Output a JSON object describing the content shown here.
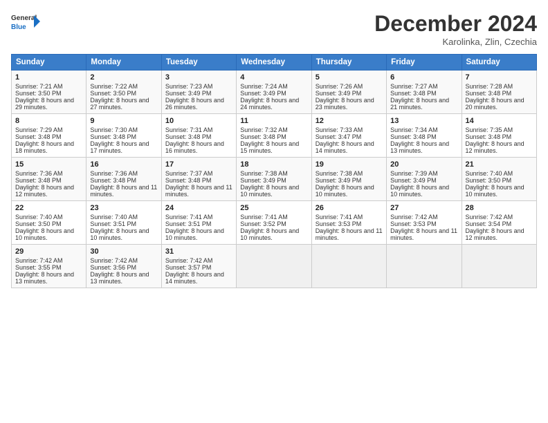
{
  "header": {
    "logo_line1": "General",
    "logo_line2": "Blue",
    "month_title": "December 2024",
    "location": "Karolinka, Zlin, Czechia"
  },
  "days_of_week": [
    "Sunday",
    "Monday",
    "Tuesday",
    "Wednesday",
    "Thursday",
    "Friday",
    "Saturday"
  ],
  "weeks": [
    [
      {
        "day": "1",
        "sunrise": "Sunrise: 7:21 AM",
        "sunset": "Sunset: 3:50 PM",
        "daylight": "Daylight: 8 hours and 29 minutes."
      },
      {
        "day": "2",
        "sunrise": "Sunrise: 7:22 AM",
        "sunset": "Sunset: 3:50 PM",
        "daylight": "Daylight: 8 hours and 27 minutes."
      },
      {
        "day": "3",
        "sunrise": "Sunrise: 7:23 AM",
        "sunset": "Sunset: 3:49 PM",
        "daylight": "Daylight: 8 hours and 26 minutes."
      },
      {
        "day": "4",
        "sunrise": "Sunrise: 7:24 AM",
        "sunset": "Sunset: 3:49 PM",
        "daylight": "Daylight: 8 hours and 24 minutes."
      },
      {
        "day": "5",
        "sunrise": "Sunrise: 7:26 AM",
        "sunset": "Sunset: 3:49 PM",
        "daylight": "Daylight: 8 hours and 23 minutes."
      },
      {
        "day": "6",
        "sunrise": "Sunrise: 7:27 AM",
        "sunset": "Sunset: 3:48 PM",
        "daylight": "Daylight: 8 hours and 21 minutes."
      },
      {
        "day": "7",
        "sunrise": "Sunrise: 7:28 AM",
        "sunset": "Sunset: 3:48 PM",
        "daylight": "Daylight: 8 hours and 20 minutes."
      }
    ],
    [
      {
        "day": "8",
        "sunrise": "Sunrise: 7:29 AM",
        "sunset": "Sunset: 3:48 PM",
        "daylight": "Daylight: 8 hours and 18 minutes."
      },
      {
        "day": "9",
        "sunrise": "Sunrise: 7:30 AM",
        "sunset": "Sunset: 3:48 PM",
        "daylight": "Daylight: 8 hours and 17 minutes."
      },
      {
        "day": "10",
        "sunrise": "Sunrise: 7:31 AM",
        "sunset": "Sunset: 3:48 PM",
        "daylight": "Daylight: 8 hours and 16 minutes."
      },
      {
        "day": "11",
        "sunrise": "Sunrise: 7:32 AM",
        "sunset": "Sunset: 3:48 PM",
        "daylight": "Daylight: 8 hours and 15 minutes."
      },
      {
        "day": "12",
        "sunrise": "Sunrise: 7:33 AM",
        "sunset": "Sunset: 3:47 PM",
        "daylight": "Daylight: 8 hours and 14 minutes."
      },
      {
        "day": "13",
        "sunrise": "Sunrise: 7:34 AM",
        "sunset": "Sunset: 3:48 PM",
        "daylight": "Daylight: 8 hours and 13 minutes."
      },
      {
        "day": "14",
        "sunrise": "Sunrise: 7:35 AM",
        "sunset": "Sunset: 3:48 PM",
        "daylight": "Daylight: 8 hours and 12 minutes."
      }
    ],
    [
      {
        "day": "15",
        "sunrise": "Sunrise: 7:36 AM",
        "sunset": "Sunset: 3:48 PM",
        "daylight": "Daylight: 8 hours and 12 minutes."
      },
      {
        "day": "16",
        "sunrise": "Sunrise: 7:36 AM",
        "sunset": "Sunset: 3:48 PM",
        "daylight": "Daylight: 8 hours and 11 minutes."
      },
      {
        "day": "17",
        "sunrise": "Sunrise: 7:37 AM",
        "sunset": "Sunset: 3:48 PM",
        "daylight": "Daylight: 8 hours and 11 minutes."
      },
      {
        "day": "18",
        "sunrise": "Sunrise: 7:38 AM",
        "sunset": "Sunset: 3:49 PM",
        "daylight": "Daylight: 8 hours and 10 minutes."
      },
      {
        "day": "19",
        "sunrise": "Sunrise: 7:38 AM",
        "sunset": "Sunset: 3:49 PM",
        "daylight": "Daylight: 8 hours and 10 minutes."
      },
      {
        "day": "20",
        "sunrise": "Sunrise: 7:39 AM",
        "sunset": "Sunset: 3:49 PM",
        "daylight": "Daylight: 8 hours and 10 minutes."
      },
      {
        "day": "21",
        "sunrise": "Sunrise: 7:40 AM",
        "sunset": "Sunset: 3:50 PM",
        "daylight": "Daylight: 8 hours and 10 minutes."
      }
    ],
    [
      {
        "day": "22",
        "sunrise": "Sunrise: 7:40 AM",
        "sunset": "Sunset: 3:50 PM",
        "daylight": "Daylight: 8 hours and 10 minutes."
      },
      {
        "day": "23",
        "sunrise": "Sunrise: 7:40 AM",
        "sunset": "Sunset: 3:51 PM",
        "daylight": "Daylight: 8 hours and 10 minutes."
      },
      {
        "day": "24",
        "sunrise": "Sunrise: 7:41 AM",
        "sunset": "Sunset: 3:51 PM",
        "daylight": "Daylight: 8 hours and 10 minutes."
      },
      {
        "day": "25",
        "sunrise": "Sunrise: 7:41 AM",
        "sunset": "Sunset: 3:52 PM",
        "daylight": "Daylight: 8 hours and 10 minutes."
      },
      {
        "day": "26",
        "sunrise": "Sunrise: 7:41 AM",
        "sunset": "Sunset: 3:53 PM",
        "daylight": "Daylight: 8 hours and 11 minutes."
      },
      {
        "day": "27",
        "sunrise": "Sunrise: 7:42 AM",
        "sunset": "Sunset: 3:53 PM",
        "daylight": "Daylight: 8 hours and 11 minutes."
      },
      {
        "day": "28",
        "sunrise": "Sunrise: 7:42 AM",
        "sunset": "Sunset: 3:54 PM",
        "daylight": "Daylight: 8 hours and 12 minutes."
      }
    ],
    [
      {
        "day": "29",
        "sunrise": "Sunrise: 7:42 AM",
        "sunset": "Sunset: 3:55 PM",
        "daylight": "Daylight: 8 hours and 13 minutes."
      },
      {
        "day": "30",
        "sunrise": "Sunrise: 7:42 AM",
        "sunset": "Sunset: 3:56 PM",
        "daylight": "Daylight: 8 hours and 13 minutes."
      },
      {
        "day": "31",
        "sunrise": "Sunrise: 7:42 AM",
        "sunset": "Sunset: 3:57 PM",
        "daylight": "Daylight: 8 hours and 14 minutes."
      },
      null,
      null,
      null,
      null
    ]
  ]
}
